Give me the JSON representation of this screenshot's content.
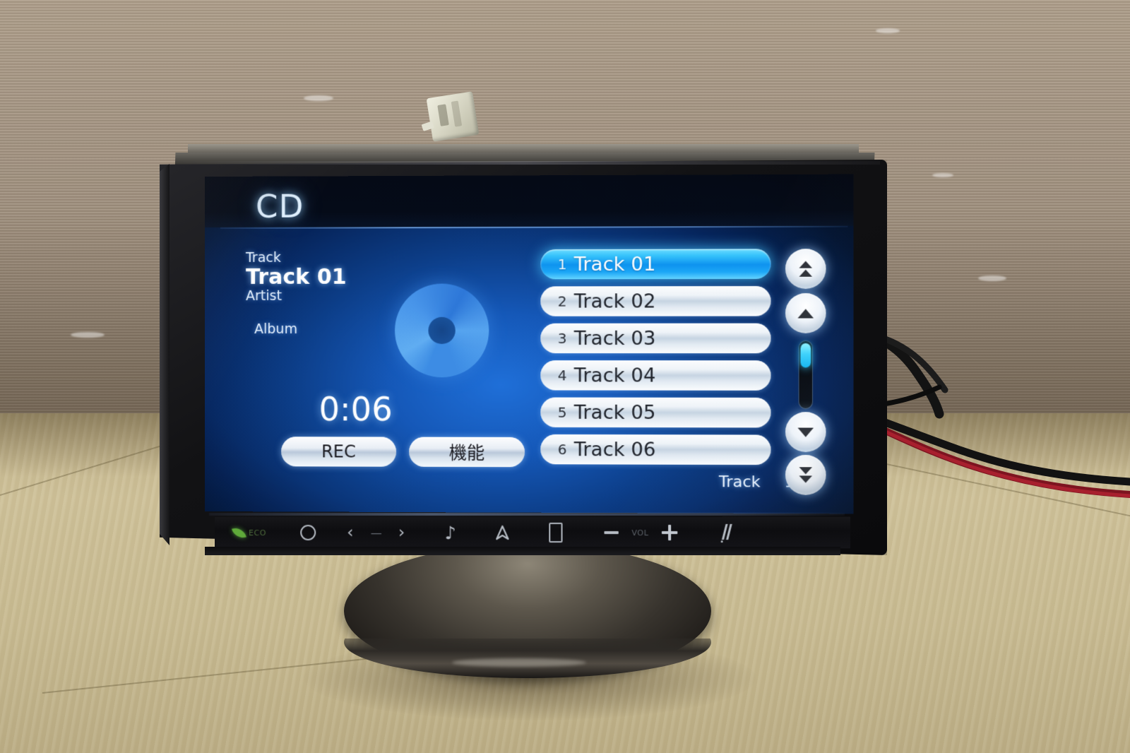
{
  "device": {
    "type": "car-audio-head-unit",
    "connector_label": "white-wiring-connector"
  },
  "screen": {
    "source_label": "CD",
    "now_playing": {
      "track_caption": "Track",
      "track_title": "Track 01",
      "artist_caption": "Artist",
      "album_caption": "Album",
      "elapsed_time": "0:06"
    },
    "buttons": {
      "rec_label": "REC",
      "function_label": "機能"
    },
    "track_list": [
      {
        "num": "1",
        "name": "Track 01",
        "selected": true
      },
      {
        "num": "2",
        "name": "Track 02",
        "selected": false
      },
      {
        "num": "3",
        "name": "Track 03",
        "selected": false
      },
      {
        "num": "4",
        "name": "Track 04",
        "selected": false
      },
      {
        "num": "5",
        "name": "Track 05",
        "selected": false
      },
      {
        "num": "6",
        "name": "Track 06",
        "selected": false
      }
    ],
    "status": {
      "track_caption": "Track",
      "track_position": "1/14"
    },
    "scroll": {
      "page_up_icon": "double-chevron-up-icon",
      "line_up_icon": "chevron-up-icon",
      "line_down_icon": "chevron-down-icon",
      "page_down_icon": "double-chevron-down-icon",
      "thumb_position_pct": 2
    },
    "colors": {
      "accent_cyan": "#1ba6f6",
      "screen_blue": "#1558b8",
      "screen_dark": "#02091a",
      "button_face": "#e8eef5"
    }
  },
  "hardkeys": [
    {
      "id": "eco-indicator",
      "icon": "leaf-icon",
      "label": "ECO"
    },
    {
      "id": "power-key",
      "icon": "circle-icon",
      "label": ""
    },
    {
      "id": "prev-track-key",
      "icon": "chevron-left-icon",
      "label": "‹"
    },
    {
      "id": "seek-dash",
      "icon": "dash-icon",
      "label": "—"
    },
    {
      "id": "next-track-key",
      "icon": "chevron-right-icon",
      "label": "›"
    },
    {
      "id": "audio-key",
      "icon": "music-note-icon",
      "label": "♪"
    },
    {
      "id": "navi-key",
      "icon": "navigation-icon",
      "label": ""
    },
    {
      "id": "display-key",
      "icon": "display-rectangle-icon",
      "label": ""
    },
    {
      "id": "volume-down-key",
      "icon": "minus-icon",
      "label": ""
    },
    {
      "id": "volume-label",
      "icon": "vol-text",
      "label": "VOL"
    },
    {
      "id": "volume-up-key",
      "icon": "plus-icon",
      "label": ""
    },
    {
      "id": "eject-key",
      "icon": "eject-icon",
      "label": ""
    }
  ],
  "environment": {
    "wall": "corrugated-cardboard",
    "floor": "plywood-board",
    "stand": "metal-cone-stand",
    "wires": [
      "black-wire",
      "red-wire"
    ]
  }
}
